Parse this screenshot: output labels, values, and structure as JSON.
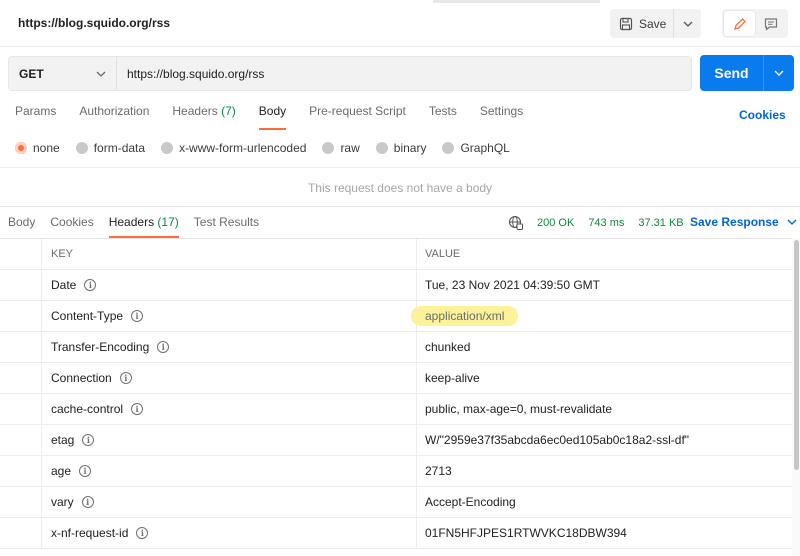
{
  "tab": {
    "title": "https://blog.squido.org/rss"
  },
  "toolbar": {
    "save_label": "Save"
  },
  "request": {
    "method": "GET",
    "url": "https://blog.squido.org/rss",
    "send_label": "Send",
    "tabs": [
      {
        "label": "Params"
      },
      {
        "label": "Authorization"
      },
      {
        "label": "Headers",
        "count": "(7)"
      },
      {
        "label": "Body",
        "active": true
      },
      {
        "label": "Pre-request Script"
      },
      {
        "label": "Tests"
      },
      {
        "label": "Settings"
      }
    ],
    "cookies_label": "Cookies",
    "body_types": [
      "none",
      "form-data",
      "x-www-form-urlencoded",
      "raw",
      "binary",
      "GraphQL"
    ],
    "selected_body_type": "none",
    "no_body_text": "This request does not have a body"
  },
  "response": {
    "tabs": [
      {
        "label": "Body"
      },
      {
        "label": "Cookies"
      },
      {
        "label": "Headers",
        "count": "(17)",
        "active": true
      },
      {
        "label": "Test Results"
      }
    ],
    "status": "200 OK",
    "time": "743 ms",
    "size": "37.31 KB",
    "save_response_label": "Save Response",
    "columns": {
      "key": "KEY",
      "value": "VALUE"
    },
    "headers": [
      {
        "key": "Date",
        "value": "Tue, 23 Nov 2021 04:39:50 GMT"
      },
      {
        "key": "Content-Type",
        "value": "application/xml"
      },
      {
        "key": "Transfer-Encoding",
        "value": "chunked"
      },
      {
        "key": "Connection",
        "value": "keep-alive"
      },
      {
        "key": "cache-control",
        "value": "public, max-age=0, must-revalidate"
      },
      {
        "key": "etag",
        "value": "W/\"2959e37f35abcda6ec0ed105ab0c18a2-ssl-df\""
      },
      {
        "key": "age",
        "value": "2713"
      },
      {
        "key": "vary",
        "value": "Accept-Encoding"
      },
      {
        "key": "x-nf-request-id",
        "value": "01FN5HFJPES1RTWVKC18DBW394"
      }
    ]
  },
  "colors": {
    "accent": "#ff6c37",
    "send": "#097bed",
    "link": "#0265d2",
    "status_ok": "#0c8a3c",
    "highlight": "#fbf29a"
  }
}
